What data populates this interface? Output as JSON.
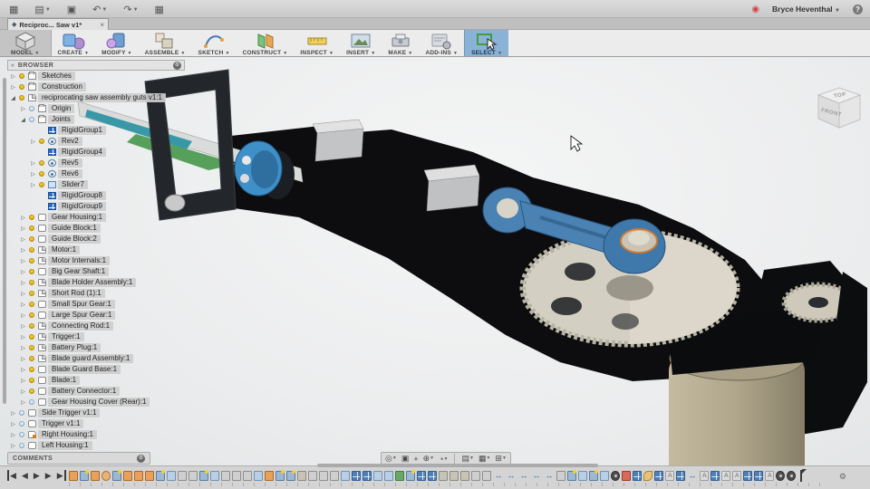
{
  "window": {
    "tab_title": "Reciproc... Saw v1*",
    "tab_close": "×",
    "user_name": "Bryce Heventhal",
    "quick_icons": [
      {
        "name": "app-grid-icon",
        "glyph": "▦",
        "caret": false
      },
      {
        "name": "file-menu-icon",
        "glyph": "▤",
        "caret": true
      },
      {
        "name": "save-icon",
        "glyph": "▣",
        "caret": false
      },
      {
        "name": "undo-icon",
        "glyph": "↶",
        "caret": true
      },
      {
        "name": "redo-icon",
        "glyph": "↷",
        "caret": true
      },
      {
        "name": "data-panel-icon",
        "glyph": "▦",
        "caret": false
      }
    ],
    "record_glyph": "◉",
    "help_glyph": "?"
  },
  "toolbar": {
    "groups": [
      {
        "key": "model",
        "label": "MODEL"
      },
      {
        "key": "create",
        "label": "CREATE"
      },
      {
        "key": "modify",
        "label": "MODIFY"
      },
      {
        "key": "assemble",
        "label": "ASSEMBLE"
      },
      {
        "key": "sketch",
        "label": "SKETCH"
      },
      {
        "key": "construct",
        "label": "CONSTRUCT"
      },
      {
        "key": "inspect",
        "label": "INSPECT"
      },
      {
        "key": "insert",
        "label": "INSERT"
      },
      {
        "key": "make",
        "label": "MAKE"
      },
      {
        "key": "addins",
        "label": "ADD-INS"
      },
      {
        "key": "select",
        "label": "SELECT"
      }
    ]
  },
  "browser": {
    "title": "BROWSER",
    "collapse_glyph": "«",
    "items": [
      {
        "label": "Sketches",
        "level": 0,
        "arrow": "c",
        "bulb": "on",
        "icon": "folder"
      },
      {
        "label": "Construction",
        "level": 0,
        "arrow": "c",
        "bulb": "on",
        "icon": "folder"
      },
      {
        "label": "reciprocating saw assembly guts v1:1",
        "level": 0,
        "arrow": "e",
        "bulb": "on",
        "icon": "comp"
      },
      {
        "label": "Origin",
        "level": 1,
        "arrow": "c",
        "bulb": "off",
        "icon": "folder"
      },
      {
        "label": "Joints",
        "level": 1,
        "arrow": "e",
        "bulb": "off",
        "icon": "folder"
      },
      {
        "label": "RigidGroup1",
        "level": 2,
        "arrow": "n",
        "bulb": "none",
        "icon": "rigid"
      },
      {
        "label": "Rev2",
        "level": 2,
        "arrow": "c",
        "bulb": "on",
        "icon": "rev"
      },
      {
        "label": "RigidGroup4",
        "level": 2,
        "arrow": "n",
        "bulb": "none",
        "icon": "rigid"
      },
      {
        "label": "Rev5",
        "level": 2,
        "arrow": "c",
        "bulb": "on",
        "icon": "rev"
      },
      {
        "label": "Rev6",
        "level": 2,
        "arrow": "c",
        "bulb": "on",
        "icon": "rev"
      },
      {
        "label": "Slider7",
        "level": 2,
        "arrow": "c",
        "bulb": "on",
        "icon": "slider"
      },
      {
        "label": "RigidGroup8",
        "level": 2,
        "arrow": "n",
        "bulb": "none",
        "icon": "rigid"
      },
      {
        "label": "RigidGroup9",
        "level": 2,
        "arrow": "n",
        "bulb": "none",
        "icon": "rigid"
      },
      {
        "label": "Gear Housing:1",
        "level": 1,
        "arrow": "c",
        "bulb": "on",
        "icon": "body"
      },
      {
        "label": "Guide Block:1",
        "level": 1,
        "arrow": "c",
        "bulb": "on",
        "icon": "body"
      },
      {
        "label": "Guide Block:2",
        "level": 1,
        "arrow": "c",
        "bulb": "on",
        "icon": "body"
      },
      {
        "label": "Motor:1",
        "level": 1,
        "arrow": "c",
        "bulb": "on",
        "icon": "comp"
      },
      {
        "label": "Motor Internals:1",
        "level": 1,
        "arrow": "c",
        "bulb": "on",
        "icon": "comp"
      },
      {
        "label": "Big Gear Shaft:1",
        "level": 1,
        "arrow": "c",
        "bulb": "on",
        "icon": "body"
      },
      {
        "label": "Blade Holder Assembly:1",
        "level": 1,
        "arrow": "c",
        "bulb": "on",
        "icon": "comp"
      },
      {
        "label": "Short Rod (1):1",
        "level": 1,
        "arrow": "c",
        "bulb": "on",
        "icon": "comp"
      },
      {
        "label": "Small Spur Gear:1",
        "level": 1,
        "arrow": "c",
        "bulb": "on",
        "icon": "body"
      },
      {
        "label": "Large Spur Gear:1",
        "level": 1,
        "arrow": "c",
        "bulb": "on",
        "icon": "body"
      },
      {
        "label": "Connecting Rod:1",
        "level": 1,
        "arrow": "c",
        "bulb": "on",
        "icon": "comp"
      },
      {
        "label": "Trigger:1",
        "level": 1,
        "arrow": "c",
        "bulb": "on",
        "icon": "comp"
      },
      {
        "label": "Battery Plug:1",
        "level": 1,
        "arrow": "c",
        "bulb": "on",
        "icon": "comp"
      },
      {
        "label": "Blade guard Assembly:1",
        "level": 1,
        "arrow": "c",
        "bulb": "on",
        "icon": "comp"
      },
      {
        "label": "Blade Guard Base:1",
        "level": 1,
        "arrow": "c",
        "bulb": "on",
        "icon": "body"
      },
      {
        "label": "Blade:1",
        "level": 1,
        "arrow": "c",
        "bulb": "on",
        "icon": "body"
      },
      {
        "label": "Battery Connector:1",
        "level": 1,
        "arrow": "c",
        "bulb": "on",
        "icon": "body"
      },
      {
        "label": "Gear Housing Cover (Rear):1",
        "level": 1,
        "arrow": "c",
        "bulb": "off",
        "icon": "body"
      },
      {
        "label": "Side Trigger v1:1",
        "level": 0,
        "arrow": "c",
        "bulb": "off",
        "icon": "body"
      },
      {
        "label": "Trigger v1:1",
        "level": 0,
        "arrow": "c",
        "bulb": "off",
        "icon": "body"
      },
      {
        "label": "Right Housing:1",
        "level": 0,
        "arrow": "c",
        "bulb": "off",
        "icon": "complink"
      },
      {
        "label": "Left Housing:1",
        "level": 0,
        "arrow": "c",
        "bulb": "off",
        "icon": "body"
      }
    ]
  },
  "viewcube": {
    "top": "TOP",
    "front": "FRONT"
  },
  "comments": {
    "label": "COMMENTS"
  },
  "navbar": {
    "icons": [
      {
        "name": "orbit-icon",
        "glyph": "◎",
        "caret": true
      },
      {
        "name": "look-at-icon",
        "glyph": "▣",
        "caret": false
      },
      {
        "name": "pan-icon",
        "glyph": "+",
        "caret": false
      },
      {
        "name": "zoom-icon",
        "glyph": "⊕",
        "caret": true
      },
      {
        "name": "window-zoom-icon",
        "glyph": "◔",
        "caret": true
      },
      {
        "name": "sep",
        "glyph": "",
        "caret": false
      },
      {
        "name": "display-settings-icon",
        "glyph": "▤",
        "caret": true
      },
      {
        "name": "grid-layout-icon",
        "glyph": "▦",
        "caret": true
      },
      {
        "name": "viewports-icon",
        "glyph": "⊞",
        "caret": true
      }
    ]
  },
  "timeline": {
    "playback": [
      {
        "name": "go-to-start-button",
        "glyph": "◀",
        "bar": "L"
      },
      {
        "name": "step-back-button",
        "glyph": "◀",
        "bar": ""
      },
      {
        "name": "step-forward-button",
        "glyph": "▶",
        "bar": ""
      },
      {
        "name": "play-button",
        "glyph": "▶",
        "bar": ""
      },
      {
        "name": "go-to-end-button",
        "glyph": "▶",
        "bar": "R"
      }
    ],
    "gear_glyph": "⚙",
    "icons": [
      "joint",
      "sketch",
      "joint",
      "revolve",
      "sketch",
      "joint",
      "joint",
      "joint",
      "sketch",
      "component",
      "extrude",
      "extrude",
      "sketch",
      "component",
      "extrude",
      "extrude",
      "extrude",
      "component",
      "joint",
      "sketch",
      "sketch",
      "slab",
      "extrude",
      "extrude",
      "extrude",
      "component",
      "pattern",
      "pattern",
      "component",
      "component",
      "mirror",
      "sketch",
      "pattern",
      "pattern",
      "slab",
      "slab",
      "slab",
      "extrude",
      "extrude",
      "arrow",
      "arrow",
      "arrow",
      "arrow",
      "arrow",
      "extrude",
      "sketch",
      "component",
      "sketch",
      "component",
      "motor",
      "pin",
      "pattern",
      "link",
      "pattern",
      "asbuilt",
      "pattern",
      "arrow",
      "asbuilt",
      "pattern",
      "asbuilt",
      "asbuilt",
      "pattern",
      "pattern",
      "asbuilt",
      "motor",
      "motor"
    ]
  },
  "colors": {
    "select_highlight": "#8ab1d6",
    "housing_black": "#0d0d0f",
    "blade_grey": "#dadcd9",
    "blade_teal": "#3898a8",
    "blade_green": "#57a05c",
    "mechanism_blue": "#4a82b4",
    "clamp_blue": "#3f8fc9",
    "gear_tan": "#d3cfc2",
    "motor_tan": "#b0a68c",
    "bulb_on": "#f5c71e",
    "bulb_off": "#dcebf7"
  }
}
